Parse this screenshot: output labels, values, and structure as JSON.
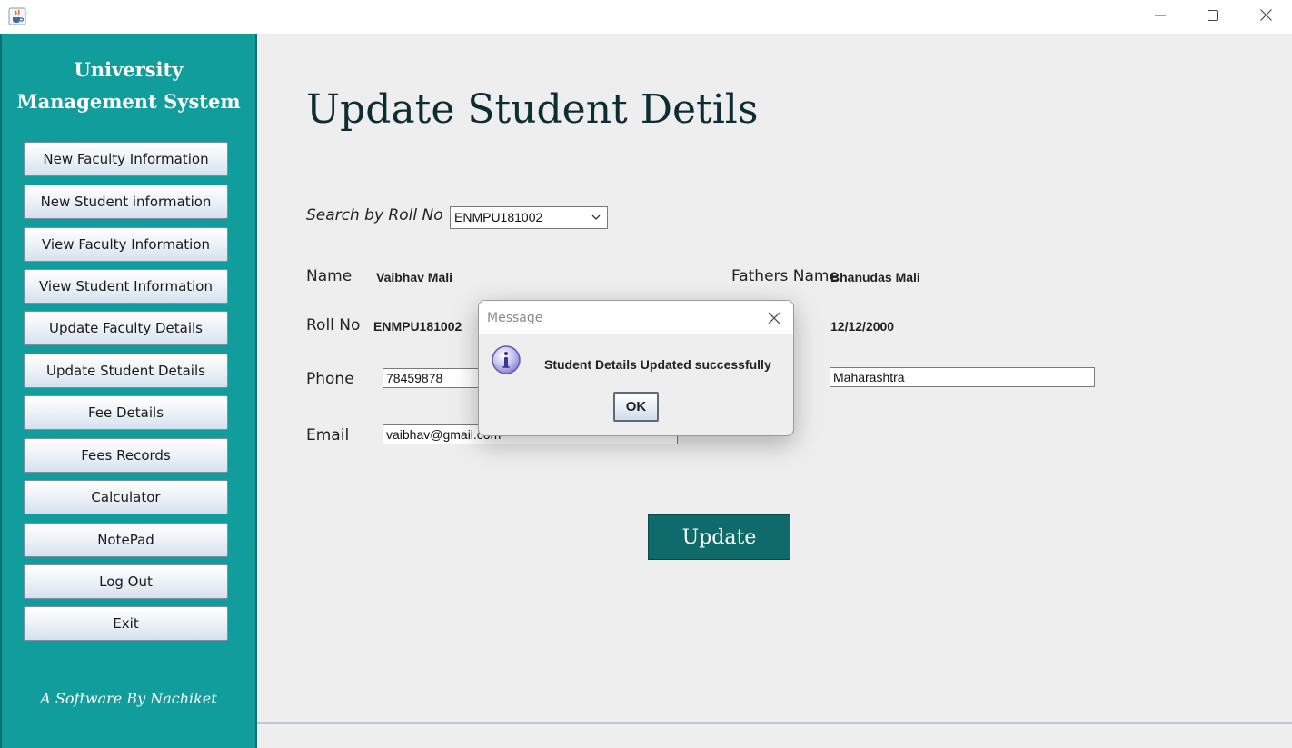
{
  "window": {
    "icon": "java-cup-icon",
    "controls": {
      "minimize": "minimize-icon",
      "maximize": "maximize-icon",
      "close": "close-icon"
    }
  },
  "sidebar": {
    "title_line1": "University",
    "title_line2": "Management System",
    "buttons": [
      "New Faculty Information",
      "New Student information",
      "View Faculty Information",
      "View Student Information",
      "Update Faculty Details",
      "Update Student Details",
      "Fee Details",
      "Fees Records",
      "Calculator",
      "NotePad",
      "Log Out",
      "Exit"
    ],
    "credit": "A Software By Nachiket",
    "background_color": "#119d9b"
  },
  "form": {
    "title": "Update Student Detils",
    "search_label": "Search by Roll No",
    "search_value": "ENMPU181002",
    "name_label": "Name",
    "name_value": "Vaibhav Mali",
    "fathers_label": "Fathers Name",
    "fathers_value": "Bhanudas Mali",
    "roll_label": "Roll No",
    "roll_value": "ENMPU181002",
    "dob_value": "12/12/2000",
    "phone_label": "Phone",
    "phone_value": "78459878",
    "address_value": "Maharashtra",
    "email_label": "Email",
    "email_value": "vaibhav@gmail.com",
    "update_label": "Update",
    "button_color": "#0f6b69"
  },
  "dialog": {
    "title": "Message",
    "message": "Student Details Updated successfully",
    "ok_label": "OK",
    "icon": "information-icon"
  }
}
